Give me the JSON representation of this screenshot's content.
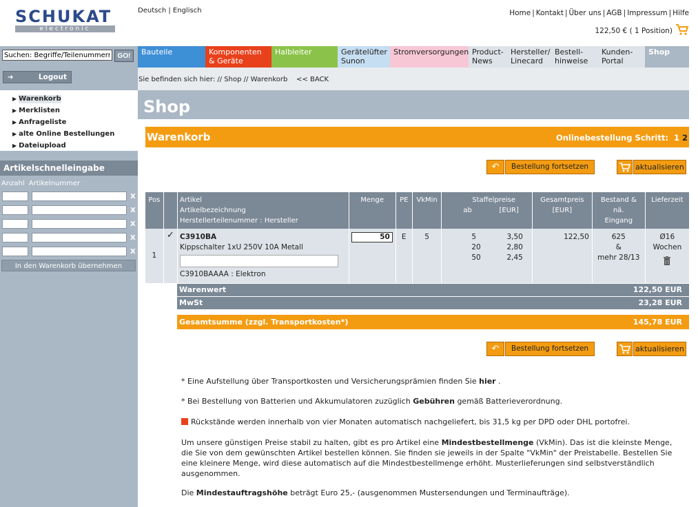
{
  "logo": {
    "brand": "SCHUKAT",
    "sub": "electronic"
  },
  "languages": [
    "Deutsch",
    "Englisch"
  ],
  "topnav": [
    "Home",
    "Kontakt",
    "Über uns",
    "AGB",
    "Impressum",
    "Hilfe"
  ],
  "cart_summary": "122,50 € ( 1 Position)",
  "search": {
    "value": "Suchen: Begriffe/Teilenummern",
    "button": "GO!"
  },
  "logout": "Logout",
  "sidebar_links": [
    "Warenkorb",
    "Merklisten",
    "Anfrageliste",
    "alte Online Bestellungen",
    "Dateiupload"
  ],
  "quick_entry": {
    "title": "Artikelschnelleingabe",
    "col_qty": "Anzahl",
    "col_art": "Artikelnummer",
    "remove": "X",
    "submit": "In den Warenkorb übernehmen"
  },
  "nav_tabs": [
    {
      "label": "Bauteile",
      "bg": "#3d8fd6",
      "fg": "#ffffff"
    },
    {
      "label": "Komponenten & Geräte",
      "bg": "#e8411c",
      "fg": "#ffffff"
    },
    {
      "label": "Halbleiter",
      "bg": "#8bc34a",
      "fg": "#ffffff"
    },
    {
      "label": "Gerätelüfter Sunon",
      "bg": "#c6def2",
      "fg": "#222222"
    },
    {
      "label": "Stromversorgungen",
      "bg": "#f7c7d6",
      "fg": "#222222"
    },
    {
      "label": "Product-News",
      "bg": "#dde3e8",
      "fg": "#222222"
    },
    {
      "label": "Hersteller/ Linecard",
      "bg": "#dde3e8",
      "fg": "#222222"
    },
    {
      "label": "Bestell-hinweise",
      "bg": "#dde3e8",
      "fg": "#222222"
    },
    {
      "label": "Kunden-Portal",
      "bg": "#dde3e8",
      "fg": "#222222"
    },
    {
      "label": "Shop",
      "bg": "#aab7c4",
      "fg": "#ffffff"
    }
  ],
  "breadcrumb": {
    "prefix": "Sie befinden sich hier: //",
    "shop": "Shop",
    "sep": "//",
    "cart": "Warenkorb",
    "back_prefix": "<<",
    "back": "BACK"
  },
  "page_title": "Shop",
  "cart_header": {
    "title": "Warenkorb",
    "steps_label": "Onlinebestellung Schritt:",
    "step1": "1",
    "step2": "2"
  },
  "buttons": {
    "back": "↶",
    "continue": "Bestellung fortsetzen",
    "update": "aktualisieren"
  },
  "table": {
    "headers": {
      "pos": "Pos",
      "artikel": [
        "Artikel",
        "Artikelbezeichnung",
        "Herstellerteilenummer : Hersteller"
      ],
      "menge": "Menge",
      "pe": "PE",
      "vkmin": "VkMin",
      "staffel": [
        "Staffelpreise",
        "ab",
        "[EUR]"
      ],
      "gesamt": [
        "Gesamtpreis",
        "[EUR]"
      ],
      "bestand": [
        "Bestand &",
        "nä.",
        "Eingang"
      ],
      "lieferzeit": "Lieferzeit"
    },
    "rows": [
      {
        "pos": "1",
        "check": "✓",
        "article": "C3910BA",
        "description": "Kippschalter 1xU 250V 10A Metall",
        "manufacturer_part": "C3910BAAAA : Elektron",
        "qty": "50",
        "pe": "E",
        "vkmin": "5",
        "tiers": [
          {
            "ab": "5",
            "price": "3,50"
          },
          {
            "ab": "20",
            "price": "2,80"
          },
          {
            "ab": "50",
            "price": "2,45"
          }
        ],
        "total": "122,50",
        "stock": [
          "625",
          "&",
          "mehr 28/13"
        ],
        "delivery": [
          "Ø16",
          "Wochen"
        ]
      }
    ]
  },
  "totals": {
    "warenwert": {
      "label": "Warenwert",
      "value": "122,50 EUR"
    },
    "mwst": {
      "label": "MwSt",
      "value": "23,28 EUR"
    },
    "gesamt": {
      "label": "Gesamtsumme (zzgl. Transportkosten*)",
      "value": "145,78 EUR"
    }
  },
  "notes": {
    "n1_pre": "* Eine Aufstellung über Transportkosten und Versicherungsprämien finden Sie",
    "n1_link": "hier",
    "n1_post": ".",
    "n2_pre": "* Bei Bestellung von Batterien und Akkumulatoren zuzüglich",
    "n2_bold": "Gebühren",
    "n2_post": "gemäß Batterieverordnung.",
    "n3": "Rückstände werden innerhalb von vier Monaten automatisch nachgeliefert, bis 31,5 kg per DPD oder DHL portofrei.",
    "n4_pre": "Um unsere günstigen Preise stabil zu halten, gibt es pro Artikel eine",
    "n4_bold": "Mindestbestellmenge",
    "n4_post": "(VkMin). Das ist die kleinste Menge, die Sie von dem gewünschten Artikel bestellen können. Sie finden sie jeweils in der Spalte \"VkMin\" der Preistabelle. Bestellen Sie eine kleinere Menge, wird diese automatisch auf die Mindestbestellmenge erhöht. Musterlieferungen sind selbstverständlich ausgenommen.",
    "n5_pre": "Die",
    "n5_bold": "Mindestauftragshöhe",
    "n5_post": "beträgt Euro 25,- (ausgenommen Mustersendungen und Terminaufträge)."
  },
  "colors": {
    "orange": "#f39c12",
    "header_blue": "#7b8896",
    "sidebar": "#aab7c4",
    "row_bg": "#dde3e8"
  }
}
